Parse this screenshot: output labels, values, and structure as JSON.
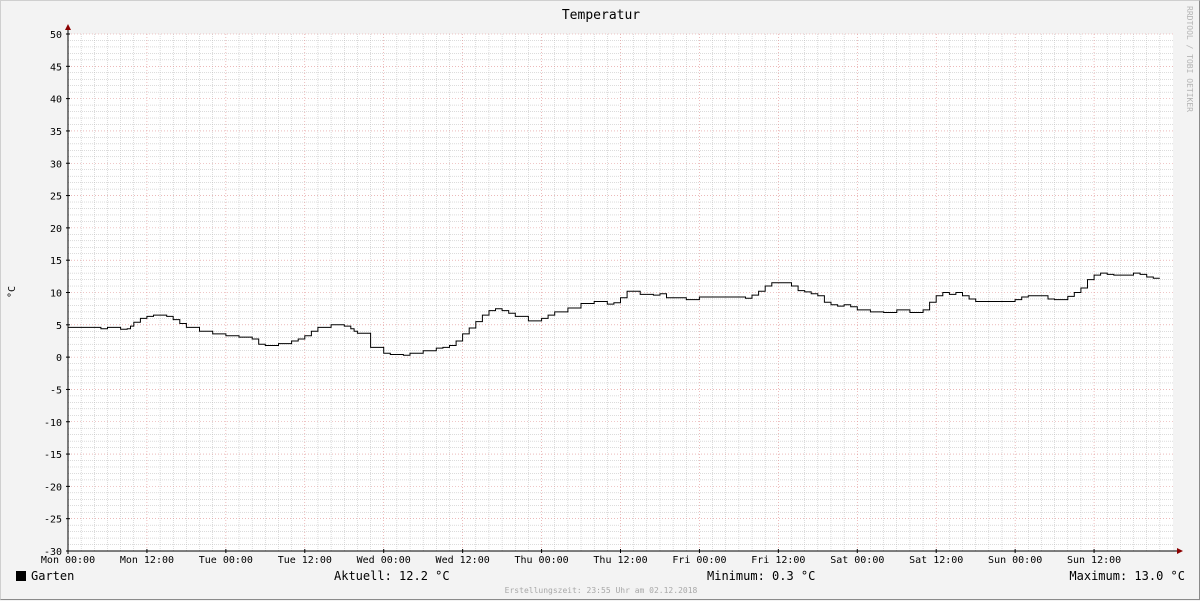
{
  "chart_data": {
    "type": "line",
    "title": "Temperatur",
    "ylabel": "°C",
    "ylim": [
      -30,
      50
    ],
    "y_ticks": [
      50,
      45,
      40,
      35,
      30,
      25,
      20,
      15,
      10,
      5,
      0,
      -5,
      -10,
      -15,
      -20,
      -25,
      -30
    ],
    "xlim_hours": [
      0,
      168
    ],
    "x_ticks": [
      {
        "label": "Mon 00:00",
        "hour": 0
      },
      {
        "label": "Mon 12:00",
        "hour": 12
      },
      {
        "label": "Tue 00:00",
        "hour": 24
      },
      {
        "label": "Tue 12:00",
        "hour": 36
      },
      {
        "label": "Wed 00:00",
        "hour": 48
      },
      {
        "label": "Wed 12:00",
        "hour": 60
      },
      {
        "label": "Thu 00:00",
        "hour": 72
      },
      {
        "label": "Thu 12:00",
        "hour": 84
      },
      {
        "label": "Fri 00:00",
        "hour": 96
      },
      {
        "label": "Fri 12:00",
        "hour": 108
      },
      {
        "label": "Sat 00:00",
        "hour": 120
      },
      {
        "label": "Sat 12:00",
        "hour": 132
      },
      {
        "label": "Sun 00:00",
        "hour": 144
      },
      {
        "label": "Sun 12:00",
        "hour": 156
      }
    ],
    "grid": true,
    "series": [
      {
        "name": "Garten",
        "color": "#000000",
        "x": [
          0,
          4,
          5,
          6,
          8,
          9,
          9.5,
          10,
          11,
          12,
          13,
          14,
          15,
          16,
          17,
          18,
          20,
          22,
          24,
          26,
          28,
          29,
          30,
          32,
          34,
          35,
          36,
          37,
          38,
          40,
          42,
          43,
          43.5,
          44,
          46,
          48,
          49,
          51,
          52,
          54,
          56,
          57,
          58,
          59,
          60,
          61,
          62,
          63,
          64,
          65,
          66,
          67,
          68,
          70,
          72,
          73,
          74,
          76,
          78,
          80,
          81,
          82,
          83,
          84,
          85,
          87,
          89,
          90,
          91,
          92,
          94,
          96,
          100,
          102,
          103,
          104,
          105,
          106,
          107,
          108,
          110,
          111,
          112,
          113,
          114,
          115,
          116,
          117,
          118,
          119,
          120,
          122,
          124,
          126,
          128,
          130,
          131,
          132,
          133,
          134,
          135,
          136,
          137,
          138,
          140,
          142,
          144,
          145,
          146,
          148,
          149,
          150,
          152,
          153,
          154,
          155,
          156,
          157,
          158,
          159,
          160,
          162,
          163,
          164,
          165,
          166
        ],
        "y": [
          4.6,
          4.6,
          4.4,
          4.6,
          4.3,
          4.4,
          4.8,
          5.4,
          6.0,
          6.3,
          6.5,
          6.5,
          6.3,
          5.8,
          5.2,
          4.6,
          4.0,
          3.6,
          3.3,
          3.1,
          2.8,
          2.0,
          1.8,
          2.1,
          2.5,
          2.8,
          3.3,
          4.0,
          4.6,
          5.0,
          4.8,
          4.4,
          4.0,
          3.7,
          1.5,
          0.6,
          0.4,
          0.3,
          0.6,
          1.0,
          1.4,
          1.5,
          1.8,
          2.5,
          3.6,
          4.5,
          5.5,
          6.5,
          7.2,
          7.5,
          7.2,
          6.8,
          6.3,
          5.6,
          6.0,
          6.5,
          7.0,
          7.6,
          8.3,
          8.6,
          8.6,
          8.2,
          8.4,
          9.2,
          10.2,
          9.7,
          9.6,
          9.8,
          9.2,
          9.2,
          8.9,
          9.3,
          9.3,
          9.3,
          9.1,
          9.6,
          10.2,
          11.0,
          11.5,
          11.5,
          11.0,
          10.3,
          10.1,
          9.8,
          9.5,
          8.5,
          8.1,
          7.9,
          8.1,
          7.8,
          7.3,
          7.0,
          6.9,
          7.3,
          6.9,
          7.3,
          8.5,
          9.5,
          10.0,
          9.7,
          10.0,
          9.5,
          9.0,
          8.6,
          8.6,
          8.6,
          8.9,
          9.3,
          9.5,
          9.5,
          9.0,
          8.9,
          9.4,
          10.0,
          10.7,
          12.0,
          12.7,
          13.0,
          12.8,
          12.7,
          12.7,
          13.0,
          12.8,
          12.4,
          12.2,
          12.2
        ]
      }
    ],
    "legend": {
      "position": "bottom-left",
      "label": "Garten",
      "swatch_color": "#000000"
    }
  },
  "stats": {
    "current": "Aktuell: 12.2 °C",
    "minimum": "Minimum: 0.3 °C",
    "maximum": "Maximum: 13.0 °C"
  },
  "footer": "Erstellungszeit: 23:55 Uhr am 02.12.2018",
  "watermark": "RRDTOOL / TOBI OETIKER",
  "colors": {
    "background": "#f3f3f3",
    "plot_area": "#ffffff",
    "major_grid": "#e09090",
    "minor_grid": "#b8b8b8",
    "axis": "#000000",
    "arrow": "#8b0000"
  }
}
